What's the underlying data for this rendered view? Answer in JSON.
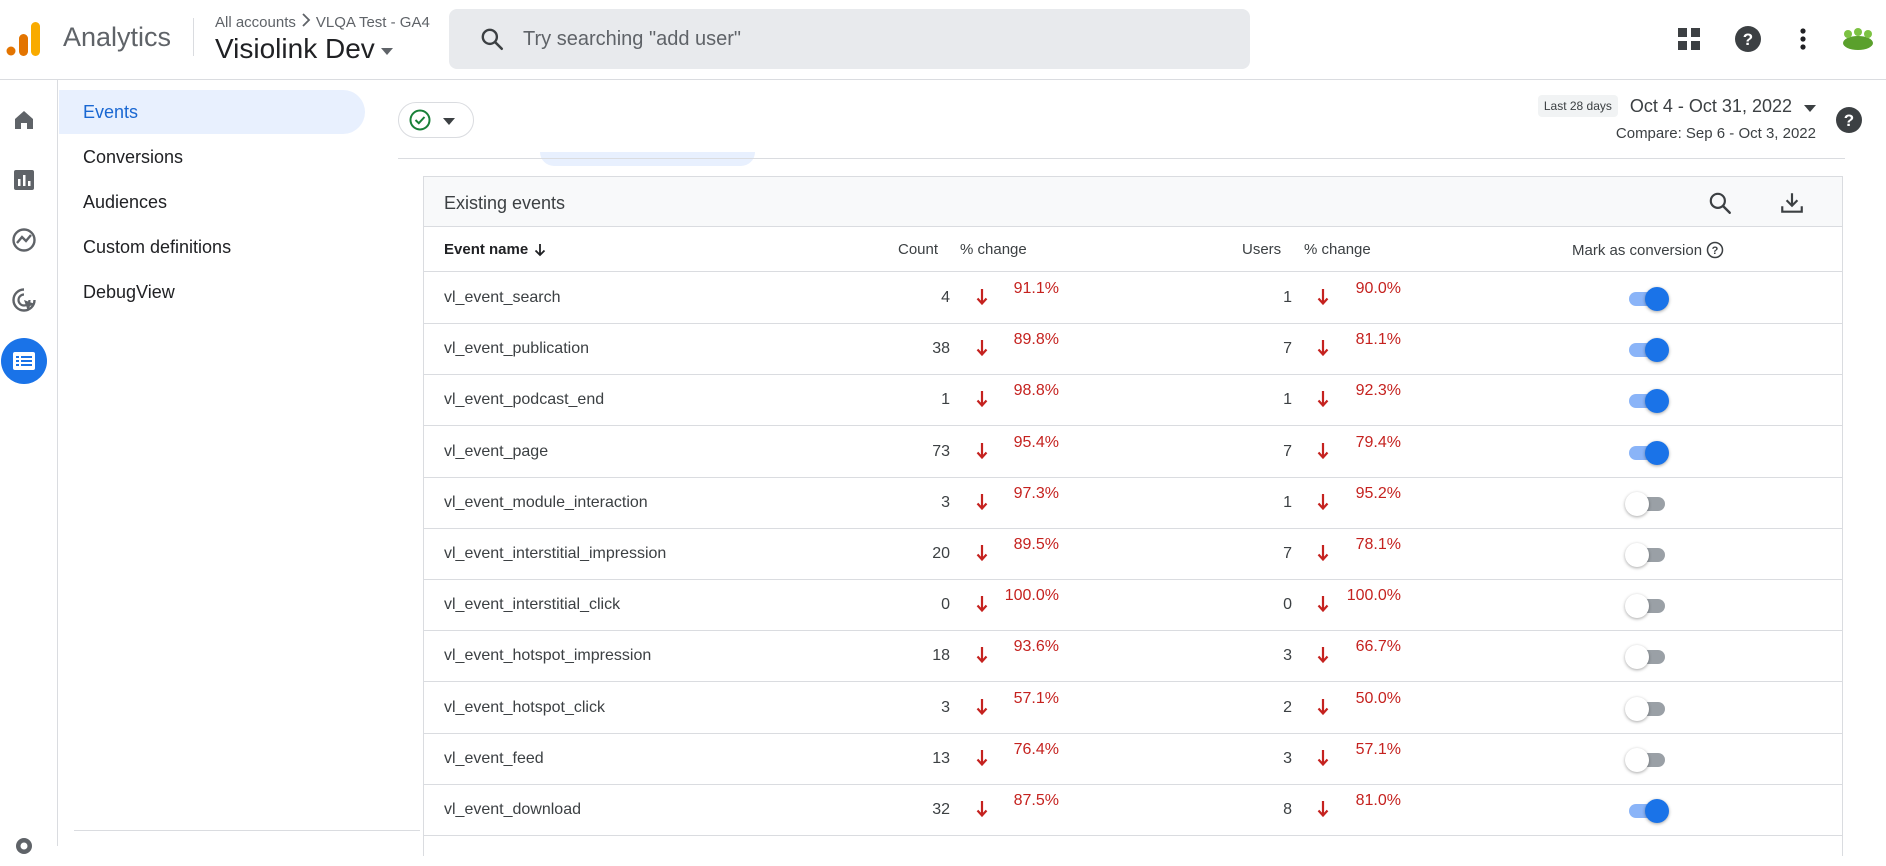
{
  "app": {
    "name": "Analytics"
  },
  "header": {
    "breadcrumb": [
      "All accounts",
      "VLQA Test - GA4"
    ],
    "property": "Visiolink Dev",
    "search_placeholder": "Try searching \"add user\""
  },
  "subnav": {
    "items": [
      {
        "label": "Events",
        "active": true
      },
      {
        "label": "Conversions",
        "active": false
      },
      {
        "label": "Audiences",
        "active": false
      },
      {
        "label": "Custom definitions",
        "active": false
      },
      {
        "label": "DebugView",
        "active": false
      }
    ]
  },
  "date": {
    "chip": "Last 28 days",
    "range": "Oct 4 - Oct 31, 2022",
    "compare": "Compare: Sep 6 - Oct 3, 2022"
  },
  "table": {
    "title": "Existing events",
    "headers": {
      "event_name": "Event name",
      "count": "Count",
      "count_change": "% change",
      "users": "Users",
      "users_change": "% change",
      "mark_conversion": "Mark as conversion"
    },
    "rows": [
      {
        "name": "vl_event_search",
        "count": "4",
        "count_change": "91.1%",
        "users": "1",
        "users_change": "90.0%",
        "conversion": true
      },
      {
        "name": "vl_event_publication",
        "count": "38",
        "count_change": "89.8%",
        "users": "7",
        "users_change": "81.1%",
        "conversion": true
      },
      {
        "name": "vl_event_podcast_end",
        "count": "1",
        "count_change": "98.8%",
        "users": "1",
        "users_change": "92.3%",
        "conversion": true
      },
      {
        "name": "vl_event_page",
        "count": "73",
        "count_change": "95.4%",
        "users": "7",
        "users_change": "79.4%",
        "conversion": true
      },
      {
        "name": "vl_event_module_interaction",
        "count": "3",
        "count_change": "97.3%",
        "users": "1",
        "users_change": "95.2%",
        "conversion": false
      },
      {
        "name": "vl_event_interstitial_impression",
        "count": "20",
        "count_change": "89.5%",
        "users": "7",
        "users_change": "78.1%",
        "conversion": false
      },
      {
        "name": "vl_event_interstitial_click",
        "count": "0",
        "count_change": "100.0%",
        "users": "0",
        "users_change": "100.0%",
        "conversion": false
      },
      {
        "name": "vl_event_hotspot_impression",
        "count": "18",
        "count_change": "93.6%",
        "users": "3",
        "users_change": "66.7%",
        "conversion": false
      },
      {
        "name": "vl_event_hotspot_click",
        "count": "3",
        "count_change": "57.1%",
        "users": "2",
        "users_change": "50.0%",
        "conversion": false
      },
      {
        "name": "vl_event_feed",
        "count": "13",
        "count_change": "76.4%",
        "users": "3",
        "users_change": "57.1%",
        "conversion": false
      },
      {
        "name": "vl_event_download",
        "count": "32",
        "count_change": "87.5%",
        "users": "8",
        "users_change": "81.0%",
        "conversion": true
      }
    ]
  },
  "colors": {
    "accent": "#1a73e8",
    "negative": "#c5221f",
    "logo_orange": "#f9ab00",
    "logo_dark_orange": "#e37400"
  }
}
